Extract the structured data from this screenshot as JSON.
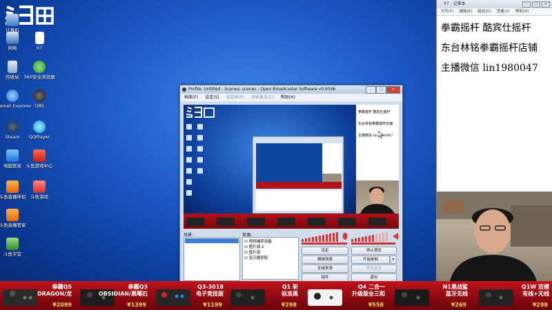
{
  "desktop": {
    "icons": [
      {
        "label": "计算机",
        "icon": "computer-icon"
      },
      {
        "label": "网络",
        "icon": "network-icon"
      },
      {
        "label": "97",
        "icon": "document-icon"
      },
      {
        "label": "回收站",
        "icon": "recycle-bin-icon"
      },
      {
        "label": "360安全浏览器",
        "icon": "browser-icon"
      },
      {
        "label": "Internet Explorer",
        "icon": "ie-icon"
      },
      {
        "label": "OBS",
        "icon": "obs-icon"
      },
      {
        "label": "Steam",
        "icon": "steam-icon"
      },
      {
        "label": "QQPlayer",
        "icon": "qqplayer-icon"
      },
      {
        "label": "电脑管家",
        "icon": "pc-manager-icon"
      },
      {
        "label": "斗鱼游戏中心",
        "icon": "game-center-icon"
      },
      {
        "label": "斗鱼直播伴侣",
        "icon": "douyu-app-icon"
      },
      {
        "label": "斗鱼游戏",
        "icon": "douyu-game-icon"
      },
      {
        "label": "斗鱼直播管家",
        "icon": "douyu-manager-icon"
      },
      {
        "label": "斗鱼学堂",
        "icon": "douyu-school-icon"
      }
    ]
  },
  "notepad": {
    "title": "97 - 记事本",
    "menu": [
      "文件(F)",
      "编辑(E)",
      "格式(O)",
      "查看(V)",
      "帮助(H)"
    ],
    "lines": [
      "拳霸摇杆  酷宾仕摇杆",
      "东台林铭拳霸摇杆店铺",
      "主播微信 lin1980047"
    ]
  },
  "obs": {
    "title": "Profile: Untitled - Scenes: scenes - Open Broadcaster Software v0.659b",
    "menu": [
      "档案(F)",
      "设定(S)",
      "设定档(P)",
      "场景集合(C)",
      "帮助(H)"
    ],
    "scenes_label": "场景:",
    "sources_label": "来源:",
    "sources": [
      {
        "name": "视频捕获设备",
        "checked": true
      },
      {
        "name": "图片源 2",
        "checked": true
      },
      {
        "name": "图片源",
        "checked": true
      },
      {
        "name": "显示器获取",
        "checked": true
      }
    ],
    "buttons": {
      "settings": "设定",
      "stop_preview": "停止预览",
      "edit_scene": "编辑场景",
      "start_recording": "开始录制",
      "global_sources": "全域来源",
      "preview_stream": "预览串流",
      "plugins": "插件",
      "exit": "退出"
    },
    "preview_notepad": [
      "拳霸摇杆  酷宾仕摇杆",
      "东台林铭拳霸摇杆店铺",
      "主播微信 lin1980047"
    ]
  },
  "banner": {
    "items": [
      {
        "name1": "拳霸Q5",
        "name2": "DRAGON/龙",
        "price": "¥2099"
      },
      {
        "name1": "拳霸Q3",
        "name2": "OBSIDIAN/黑曜石",
        "price": "¥1399"
      },
      {
        "name1": "Q3-3018",
        "name2": "电子竞技版",
        "price": "¥1199"
      },
      {
        "name1": "Q1 斩",
        "name2": "标准黑",
        "price": "¥298"
      },
      {
        "name1": "Q4 二合一",
        "name2": "升级版全三和",
        "price": "¥558"
      },
      {
        "name1": "N1黑战鲨",
        "name2": "蓝牙无线",
        "price": "¥269"
      },
      {
        "name1": "Q1W 双模",
        "name2": "有线+无线",
        "price": "¥298"
      }
    ]
  },
  "colors": {
    "accent_red": "#c0141c",
    "price_yellow": "#ffd54a",
    "desktop_blue": "#1c5ac8"
  }
}
